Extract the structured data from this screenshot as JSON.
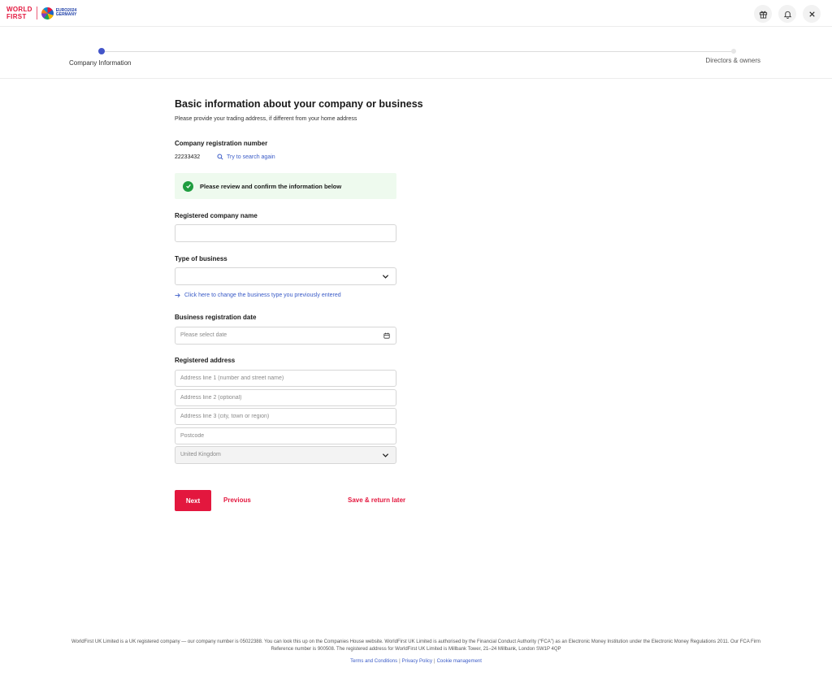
{
  "header": {
    "logo_line1": "WORLD",
    "logo_line2": "FIRST",
    "partner_line1": "EURO2024",
    "partner_line2": "GERMANY",
    "icons": [
      "gift-icon",
      "bell-icon",
      "close-icon"
    ]
  },
  "stepper": {
    "steps": [
      {
        "label": "Company Information",
        "active": true
      },
      {
        "label": "Directors & owners",
        "active": false
      }
    ],
    "accent": "#4355c9"
  },
  "form": {
    "title": "Basic information about your company or business",
    "subtitle": "Please provide your trading address, if different from your home address",
    "reg_number_label": "Company registration number",
    "reg_number_value": "22233432",
    "search_again": "Try to search again",
    "notice": "Please review and confirm the information below",
    "company_name_label": "Registered company name",
    "company_name_value": "",
    "business_type_label": "Type of business",
    "business_type_value": "",
    "change_business_link": "Click here to change the business type you previously entered",
    "reg_date_label": "Business registration date",
    "reg_date_placeholder": "Please select date",
    "address_label": "Registered address",
    "address_line1_placeholder": "Address line 1 (number and street name)",
    "address_line2_placeholder": "Address line 2 (optional)",
    "address_line3_placeholder": "Address line 3 (city, town or region)",
    "postcode_placeholder": "Postcode",
    "country_value": "United Kingdom"
  },
  "actions": {
    "next": "Next",
    "previous": "Previous",
    "save_later": "Save & return later"
  },
  "footer": {
    "text": "WorldFirst UK Limited is a UK registered company — our company number is 05022388. You can look this up on the Companies House website. WorldFirst UK Limited is authorised by the Financial Conduct Authority (“FCA”) as an Electronic Money Institution under the Electronic Money Regulations 2011. Our FCA Firm Reference number is 900508. The registered address for WorldFirst UK Limited is Millbank Tower, 21–24 Millbank, London SW1P 4QP",
    "links": [
      "Terms and Conditions",
      "Privacy Policy",
      "Cookie management"
    ]
  },
  "colors": {
    "brand": "#e3173e",
    "link": "#3a5bc7",
    "success": "#1f9d3f",
    "success_bg": "#eefaee"
  }
}
